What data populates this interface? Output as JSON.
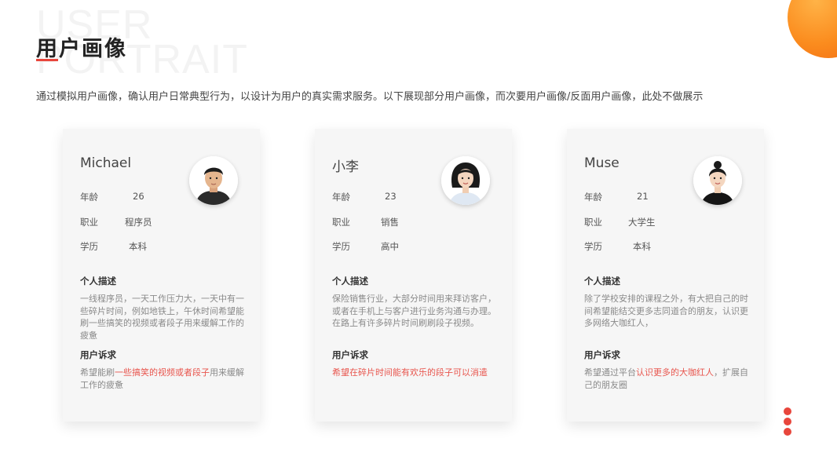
{
  "header": {
    "ghost_line1": "USER",
    "ghost_line2": "PORTRAIT",
    "title": "用户画像",
    "intro": "通过模拟用户画像，确认用户日常典型行为，以设计为用户的真实需求服务。以下展现部分用户画像，而次要用户画像/反面用户画像，此处不做展示"
  },
  "colors": {
    "accent": "#e8463c",
    "orange": "#fb8c1e",
    "card_bg": "#f6f6f6"
  },
  "cards": [
    {
      "name": "Michael",
      "avatar": "male-portrait",
      "age_label": "年龄",
      "age": "26",
      "job_label": "职业",
      "job": "程序员",
      "edu_label": "学历",
      "edu": "本科",
      "desc_title": "个人描述",
      "desc": "一线程序员，一天工作压力大，一天中有一些碎片时间，例如地铁上，午休时间希望能刷一些搞笑的视频或者段子用来缓解工作的疲惫",
      "need_title": "用户诉求",
      "need_pre": "希望能刷",
      "need_hl": "一些搞笑的视频或者段子",
      "need_post": "用来缓解工作的疲惫"
    },
    {
      "name": "小李",
      "avatar": "female-portrait",
      "age_label": "年龄",
      "age": "23",
      "job_label": "职业",
      "job": "销售",
      "edu_label": "学历",
      "edu": "高中",
      "desc_title": "个人描述",
      "desc": "保险销售行业，大部分时间用来拜访客户，或者在手机上与客户进行业务沟通与办理。在路上有许多碎片时间刷刷段子视频。",
      "need_title": "用户诉求",
      "need_pre": "",
      "need_hl": "希望在碎片时间能有欢乐的段子可以消遣",
      "need_post": ""
    },
    {
      "name": "Muse",
      "avatar": "female-portrait",
      "age_label": "年龄",
      "age": "21",
      "job_label": "职业",
      "job": "大学生",
      "edu_label": "学历",
      "edu": "本科",
      "desc_title": "个人描述",
      "desc": "除了学校安排的课程之外，有大把自己的时间希望能结交更多志同道合的朋友，认识更多网络大咖红人，",
      "need_title": "用户诉求",
      "need_pre": "希望通过平台",
      "need_hl": "认识更多的大咖红人",
      "need_post": "，扩展自己的朋友圈"
    }
  ]
}
